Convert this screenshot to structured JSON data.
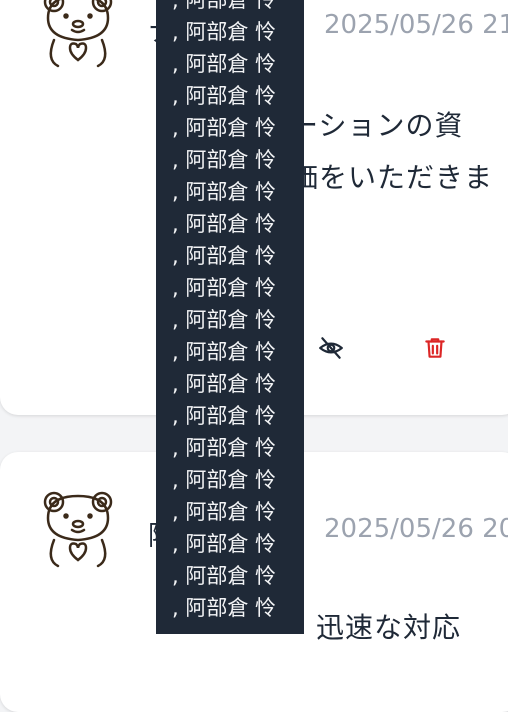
{
  "comments": [
    {
      "author_visible": "ナ",
      "timestamp": "2025/05/26 21",
      "body_lines": [
        "ーションの資",
        "価をいただきま"
      ],
      "actions": {
        "visibility_icon": "eye-off-icon",
        "delete_icon": "trash-icon"
      }
    },
    {
      "author_visible": "阿",
      "timestamp": "2025/05/26 20",
      "body_lines": [
        "迅速な対応"
      ]
    }
  ],
  "tooltip": {
    "entries": [
      ", 阿部倉 怜",
      ", 阿部倉 怜",
      ", 阿部倉 怜",
      ", 阿部倉 怜",
      ", 阿部倉 怜",
      ", 阿部倉 怜",
      ", 阿部倉 怜",
      ", 阿部倉 怜",
      ", 阿部倉 怜",
      ", 阿部倉 怜",
      ", 阿部倉 怜",
      ", 阿部倉 怜",
      ", 阿部倉 怜",
      ", 阿部倉 怜",
      ", 阿部倉 怜",
      ", 阿部倉 怜",
      ", 阿部倉 怜",
      ", 阿部倉 怜",
      ", 阿部倉 怜",
      ", 阿部倉 怜"
    ]
  },
  "colors": {
    "delete": "#dc2626",
    "tooltip_bg": "#1f2937",
    "muted": "#9ca3af"
  }
}
